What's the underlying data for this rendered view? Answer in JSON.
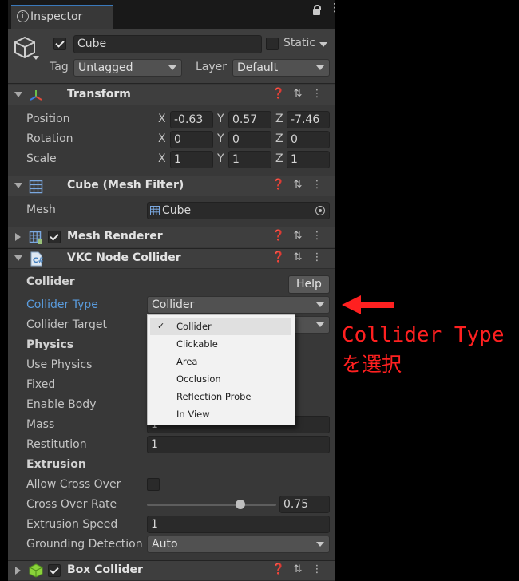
{
  "tab": {
    "title": "Inspector"
  },
  "object": {
    "name": "Cube",
    "active": true,
    "static_label": "Static",
    "tag_label": "Tag",
    "tag_value": "Untagged",
    "layer_label": "Layer",
    "layer_value": "Default"
  },
  "transform": {
    "title": "Transform",
    "rows": [
      {
        "label": "Position",
        "x": "-0.63",
        "y": "0.57",
        "z": "-7.46"
      },
      {
        "label": "Rotation",
        "x": "0",
        "y": "0",
        "z": "0"
      },
      {
        "label": "Scale",
        "x": "1",
        "y": "1",
        "z": "1"
      }
    ],
    "axes": {
      "x": "X",
      "y": "Y",
      "z": "Z"
    }
  },
  "mesh_filter": {
    "title": "Cube (Mesh Filter)",
    "mesh_label": "Mesh",
    "mesh_value": "Cube"
  },
  "mesh_renderer": {
    "title": "Mesh Renderer",
    "enabled": true
  },
  "collider_component": {
    "title": "VKC Node Collider",
    "section_collider": "Collider",
    "help_label": "Help",
    "collider_type_label": "Collider Type",
    "collider_type_value": "Collider",
    "collider_target_label": "Collider Target",
    "section_physics": "Physics",
    "use_physics_label": "Use Physics",
    "fixed_label": "Fixed",
    "enable_body_label": "Enable Body",
    "mass_label": "Mass",
    "mass_value": "1",
    "restitution_label": "Restitution",
    "restitution_value": "1",
    "section_extrusion": "Extrusion",
    "allow_cross_over_label": "Allow Cross Over",
    "cross_over_rate_label": "Cross Over Rate",
    "cross_over_rate_value": "0.75",
    "extrusion_speed_label": "Extrusion Speed",
    "extrusion_speed_value": "1",
    "grounding_detection_label": "Grounding Detection",
    "grounding_detection_value": "Auto"
  },
  "box_collider": {
    "title": "Box Collider",
    "enabled": true
  },
  "dropdown_menu": {
    "options": [
      "Collider",
      "Clickable",
      "Area",
      "Occlusion",
      "Reflection Probe",
      "In View"
    ],
    "selected": "Collider",
    "check_glyph": "✓"
  },
  "annotation": {
    "line1": "Collider Type",
    "line2": "を選択",
    "arrow_color": "#ff2020"
  },
  "colors": {
    "panel_bg": "#383838",
    "highlight_label": "#5a9cde",
    "accent_tab": "#3a79bb"
  },
  "icons": [
    "lock-icon",
    "more-vertical-icon",
    "cube-object-icon",
    "transform-axes-icon",
    "mesh-grid-icon",
    "help-circle-icon",
    "presets-icon",
    "object-picker-icon",
    "script-icon",
    "box-collider-icon"
  ]
}
